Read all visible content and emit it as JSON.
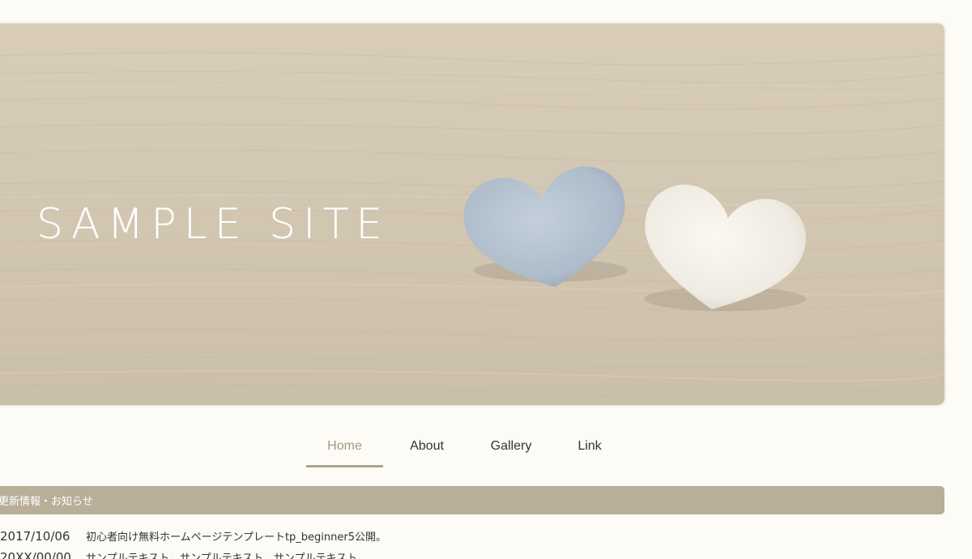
{
  "header": {
    "site_title": "SAMPLE SITE"
  },
  "nav": {
    "items": [
      {
        "label": "Home",
        "active": true
      },
      {
        "label": "About",
        "active": false
      },
      {
        "label": "Gallery",
        "active": false
      },
      {
        "label": "Link",
        "active": false
      }
    ]
  },
  "news": {
    "heading": "更新情報・お知らせ",
    "entries": [
      {
        "date": "2017/10/06",
        "text": "初心者向け無料ホームページテンプレートtp_beginner5公開。"
      },
      {
        "date": "20XX/00/00",
        "text": "サンプルテキスト。サンプルテキスト。サンプルテキスト。"
      }
    ]
  },
  "colors": {
    "accent": "#b8ae99",
    "nav_active": "#a59883",
    "background": "#fcfbf6"
  }
}
